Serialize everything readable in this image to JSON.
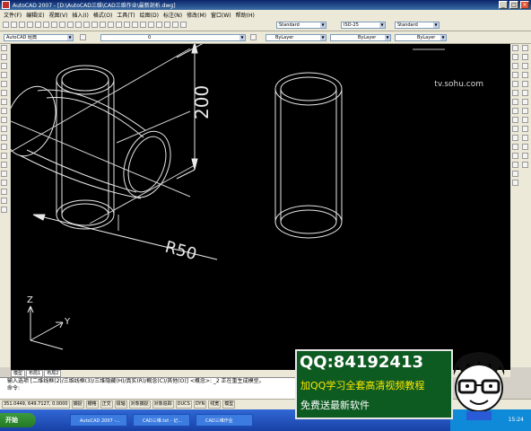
{
  "window": {
    "title": "AutoCAD 2007 - [D:\\AutoCAD三维\\CAD三维作业\\最新剖析.dwg]",
    "min_label": "_",
    "max_label": "□",
    "close_label": "×"
  },
  "menubar": [
    "文件(F)",
    "编辑(E)",
    "视图(V)",
    "插入(I)",
    "格式(O)",
    "工具(T)",
    "绘图(D)",
    "标注(N)",
    "修改(M)",
    "窗口(W)",
    "帮助(H)"
  ],
  "toolbar": {
    "text_style": "Standard",
    "dim_style": "ISO-25",
    "table_style": "Standard",
    "workspace": "AutoCAD 经典",
    "layer": "0",
    "color": "ByLayer",
    "linetype": "ByLayer",
    "lineweight": "ByLayer"
  },
  "watermark": "tv.sohu.com",
  "drawing": {
    "dim_vertical": "200",
    "dim_radius": "R50",
    "ucs_y": "Y",
    "ucs_z": "Z"
  },
  "layout_tabs": [
    "模型",
    "布局1",
    "布局2"
  ],
  "command": {
    "line1": "输入选项 [二维线框(2)/三维线框(3)/三维隐藏(H)/真实(R)/概念(C)/其他(O)] <概念>: _2 正在重生成模型。",
    "line2": "命令:"
  },
  "status": {
    "coords": "351.0449, 649.7127, 0.0000",
    "toggles": [
      "捕捉",
      "栅格",
      "正交",
      "极轴",
      "对象捕捉",
      "对象追踪",
      "DUCS",
      "DYN",
      "线宽",
      "模型"
    ]
  },
  "taskbar": {
    "start": "开始",
    "tasks": [
      "AutoCAD 2007 -...",
      "CAD三维.txt - 记...",
      "CAD三维作业"
    ],
    "clock": "15:24"
  },
  "ad": {
    "qq": "QQ:84192413",
    "line2": "加QQ学习全套高清视频教程",
    "line3": "免费送最新软件"
  }
}
